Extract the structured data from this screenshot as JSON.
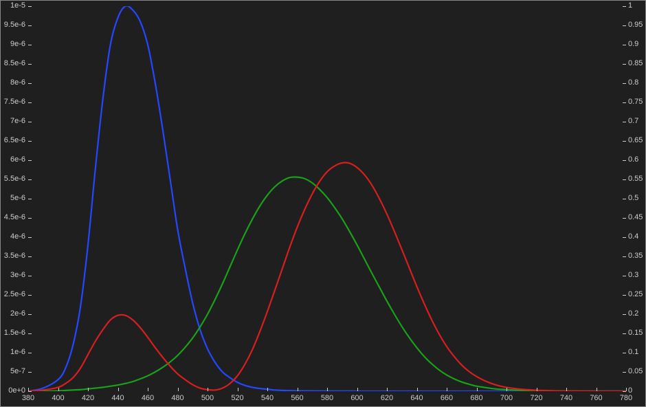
{
  "chart_data": {
    "type": "line",
    "x": [
      380,
      390,
      400,
      405,
      410,
      415,
      420,
      425,
      430,
      435,
      440,
      445,
      450,
      455,
      460,
      465,
      470,
      475,
      480,
      485,
      490,
      495,
      500,
      505,
      510,
      515,
      520,
      525,
      530,
      535,
      540,
      545,
      550,
      555,
      560,
      565,
      570,
      575,
      580,
      585,
      590,
      595,
      600,
      605,
      610,
      615,
      620,
      625,
      630,
      635,
      640,
      645,
      650,
      655,
      660,
      665,
      670,
      675,
      680,
      685,
      690,
      695,
      700,
      710,
      720,
      730,
      740,
      760,
      780
    ],
    "series": [
      {
        "name": "Blue",
        "color": "#2448ff",
        "values": [
          0.0,
          0.008,
          0.03,
          0.06,
          0.12,
          0.22,
          0.38,
          0.58,
          0.76,
          0.9,
          0.97,
          1.0,
          0.99,
          0.96,
          0.9,
          0.8,
          0.68,
          0.55,
          0.42,
          0.32,
          0.23,
          0.16,
          0.11,
          0.075,
          0.05,
          0.035,
          0.023,
          0.015,
          0.01,
          0.007,
          0.005,
          0.003,
          0.002,
          0.0015,
          0.001,
          0.0008,
          0.0006,
          0.0005,
          0.0004,
          0.0003,
          0.00025,
          0.0002,
          0.00015,
          0.0001,
          8e-05,
          6e-05,
          5e-05,
          4e-05,
          3e-05,
          2.5e-05,
          2e-05,
          1.5e-05,
          1e-05,
          8e-06,
          6e-06,
          5e-06,
          4e-06,
          3e-06,
          2e-06,
          2e-06,
          1e-06,
          1e-06,
          1e-06,
          0.0,
          0.0,
          0.0,
          0.0,
          0.0,
          0.0
        ]
      },
      {
        "name": "Green",
        "color": "#1aa01a",
        "values": [
          0.0,
          0.0,
          0.001,
          0.002,
          0.003,
          0.004,
          0.006,
          0.008,
          0.01,
          0.013,
          0.016,
          0.02,
          0.025,
          0.032,
          0.04,
          0.05,
          0.062,
          0.076,
          0.093,
          0.114,
          0.138,
          0.167,
          0.2,
          0.238,
          0.279,
          0.323,
          0.367,
          0.409,
          0.447,
          0.481,
          0.509,
          0.531,
          0.546,
          0.555,
          0.556,
          0.552,
          0.541,
          0.524,
          0.503,
          0.477,
          0.448,
          0.415,
          0.38,
          0.343,
          0.306,
          0.27,
          0.234,
          0.2,
          0.168,
          0.139,
          0.113,
          0.09,
          0.071,
          0.055,
          0.042,
          0.032,
          0.024,
          0.018,
          0.013,
          0.01,
          0.007,
          0.005,
          0.004,
          0.002,
          0.001,
          0.0005,
          0.0002,
          0.0,
          0.0
        ]
      },
      {
        "name": "Red",
        "color": "#d61f1f",
        "values": [
          0.0,
          0.003,
          0.01,
          0.02,
          0.035,
          0.06,
          0.095,
          0.13,
          0.16,
          0.185,
          0.197,
          0.197,
          0.185,
          0.165,
          0.14,
          0.113,
          0.088,
          0.065,
          0.045,
          0.03,
          0.017,
          0.008,
          0.004,
          0.003,
          0.008,
          0.02,
          0.04,
          0.07,
          0.108,
          0.155,
          0.207,
          0.262,
          0.318,
          0.374,
          0.426,
          0.472,
          0.512,
          0.545,
          0.57,
          0.585,
          0.593,
          0.592,
          0.581,
          0.562,
          0.535,
          0.5,
          0.46,
          0.415,
          0.368,
          0.32,
          0.272,
          0.227,
          0.185,
          0.148,
          0.116,
          0.09,
          0.068,
          0.051,
          0.038,
          0.028,
          0.02,
          0.014,
          0.01,
          0.005,
          0.0025,
          0.0012,
          0.0006,
          0.0002,
          0.0
        ]
      }
    ],
    "title": "",
    "xlabel": "",
    "ylabel": "",
    "xlim": [
      380,
      780
    ],
    "ylim_left": [
      0,
      1e-05
    ],
    "ylim_right": [
      0,
      1
    ],
    "x_ticks": [
      380,
      400,
      420,
      440,
      460,
      480,
      500,
      520,
      540,
      560,
      580,
      600,
      620,
      640,
      660,
      680,
      700,
      720,
      740,
      760,
      780
    ],
    "y_ticks_left": [
      "0e+0",
      "5e-7",
      "1e-6",
      "1.5e-6",
      "2e-6",
      "2.5e-6",
      "3e-6",
      "3.5e-6",
      "4e-6",
      "4.5e-6",
      "5e-6",
      "5.5e-6",
      "6e-6",
      "6.5e-6",
      "7e-6",
      "7.5e-6",
      "8e-6",
      "8.5e-6",
      "9e-6",
      "9.5e-6",
      "1e-5"
    ],
    "y_ticks_right": [
      "0",
      "0.05",
      "0.1",
      "0.15",
      "0.2",
      "0.25",
      "0.3",
      "0.35",
      "0.4",
      "0.45",
      "0.5",
      "0.55",
      "0.6",
      "0.65",
      "0.7",
      "0.75",
      "0.8",
      "0.85",
      "0.9",
      "0.95",
      "1"
    ],
    "grid": false
  }
}
